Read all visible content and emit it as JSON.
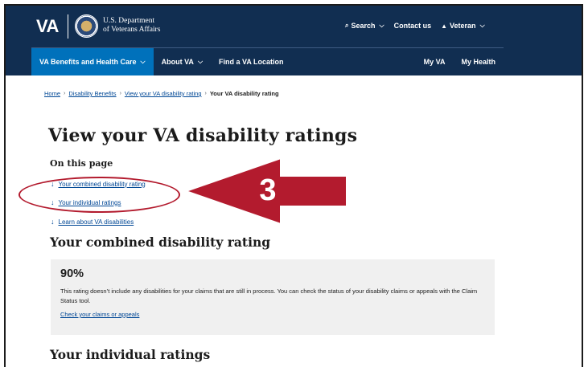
{
  "header": {
    "logo_text": "VA",
    "dept_line1": "U.S. Department",
    "dept_line2": "of Veterans Affairs",
    "search_label": "Search",
    "contact_label": "Contact us",
    "audience_label": "Veteran"
  },
  "nav": {
    "items": [
      {
        "label": "VA Benefits and Health Care"
      },
      {
        "label": "About VA"
      },
      {
        "label": "Find a VA Location"
      }
    ],
    "right_items": [
      {
        "label": "My VA"
      },
      {
        "label": "My Health"
      }
    ]
  },
  "breadcrumb": {
    "items": [
      "Home",
      "Disability Benefits",
      "View your VA disability rating"
    ],
    "current": "Your VA disability rating",
    "separator": "›"
  },
  "page": {
    "title": "View your VA disability ratings",
    "on_this_page": "On this page",
    "jump_links": [
      "Your combined disability rating",
      "Your individual ratings",
      "Learn about VA disabilities"
    ],
    "combined_heading": "Your combined disability rating",
    "combined": {
      "percent": "90%",
      "text": "This rating doesn’t include any disabilities for your claims that are still in process. You can check the status of your disability claims or appeals with the Claim Status tool.",
      "link": "Check your claims or appeals"
    },
    "individual_heading": "Your individual ratings"
  },
  "annotation": {
    "step_number": "3",
    "color": "#b31b2e"
  },
  "colors": {
    "header_bg": "#112e51",
    "active_nav_bg": "#0071bb",
    "link": "#004795",
    "card_bg": "#f0f0f0"
  }
}
